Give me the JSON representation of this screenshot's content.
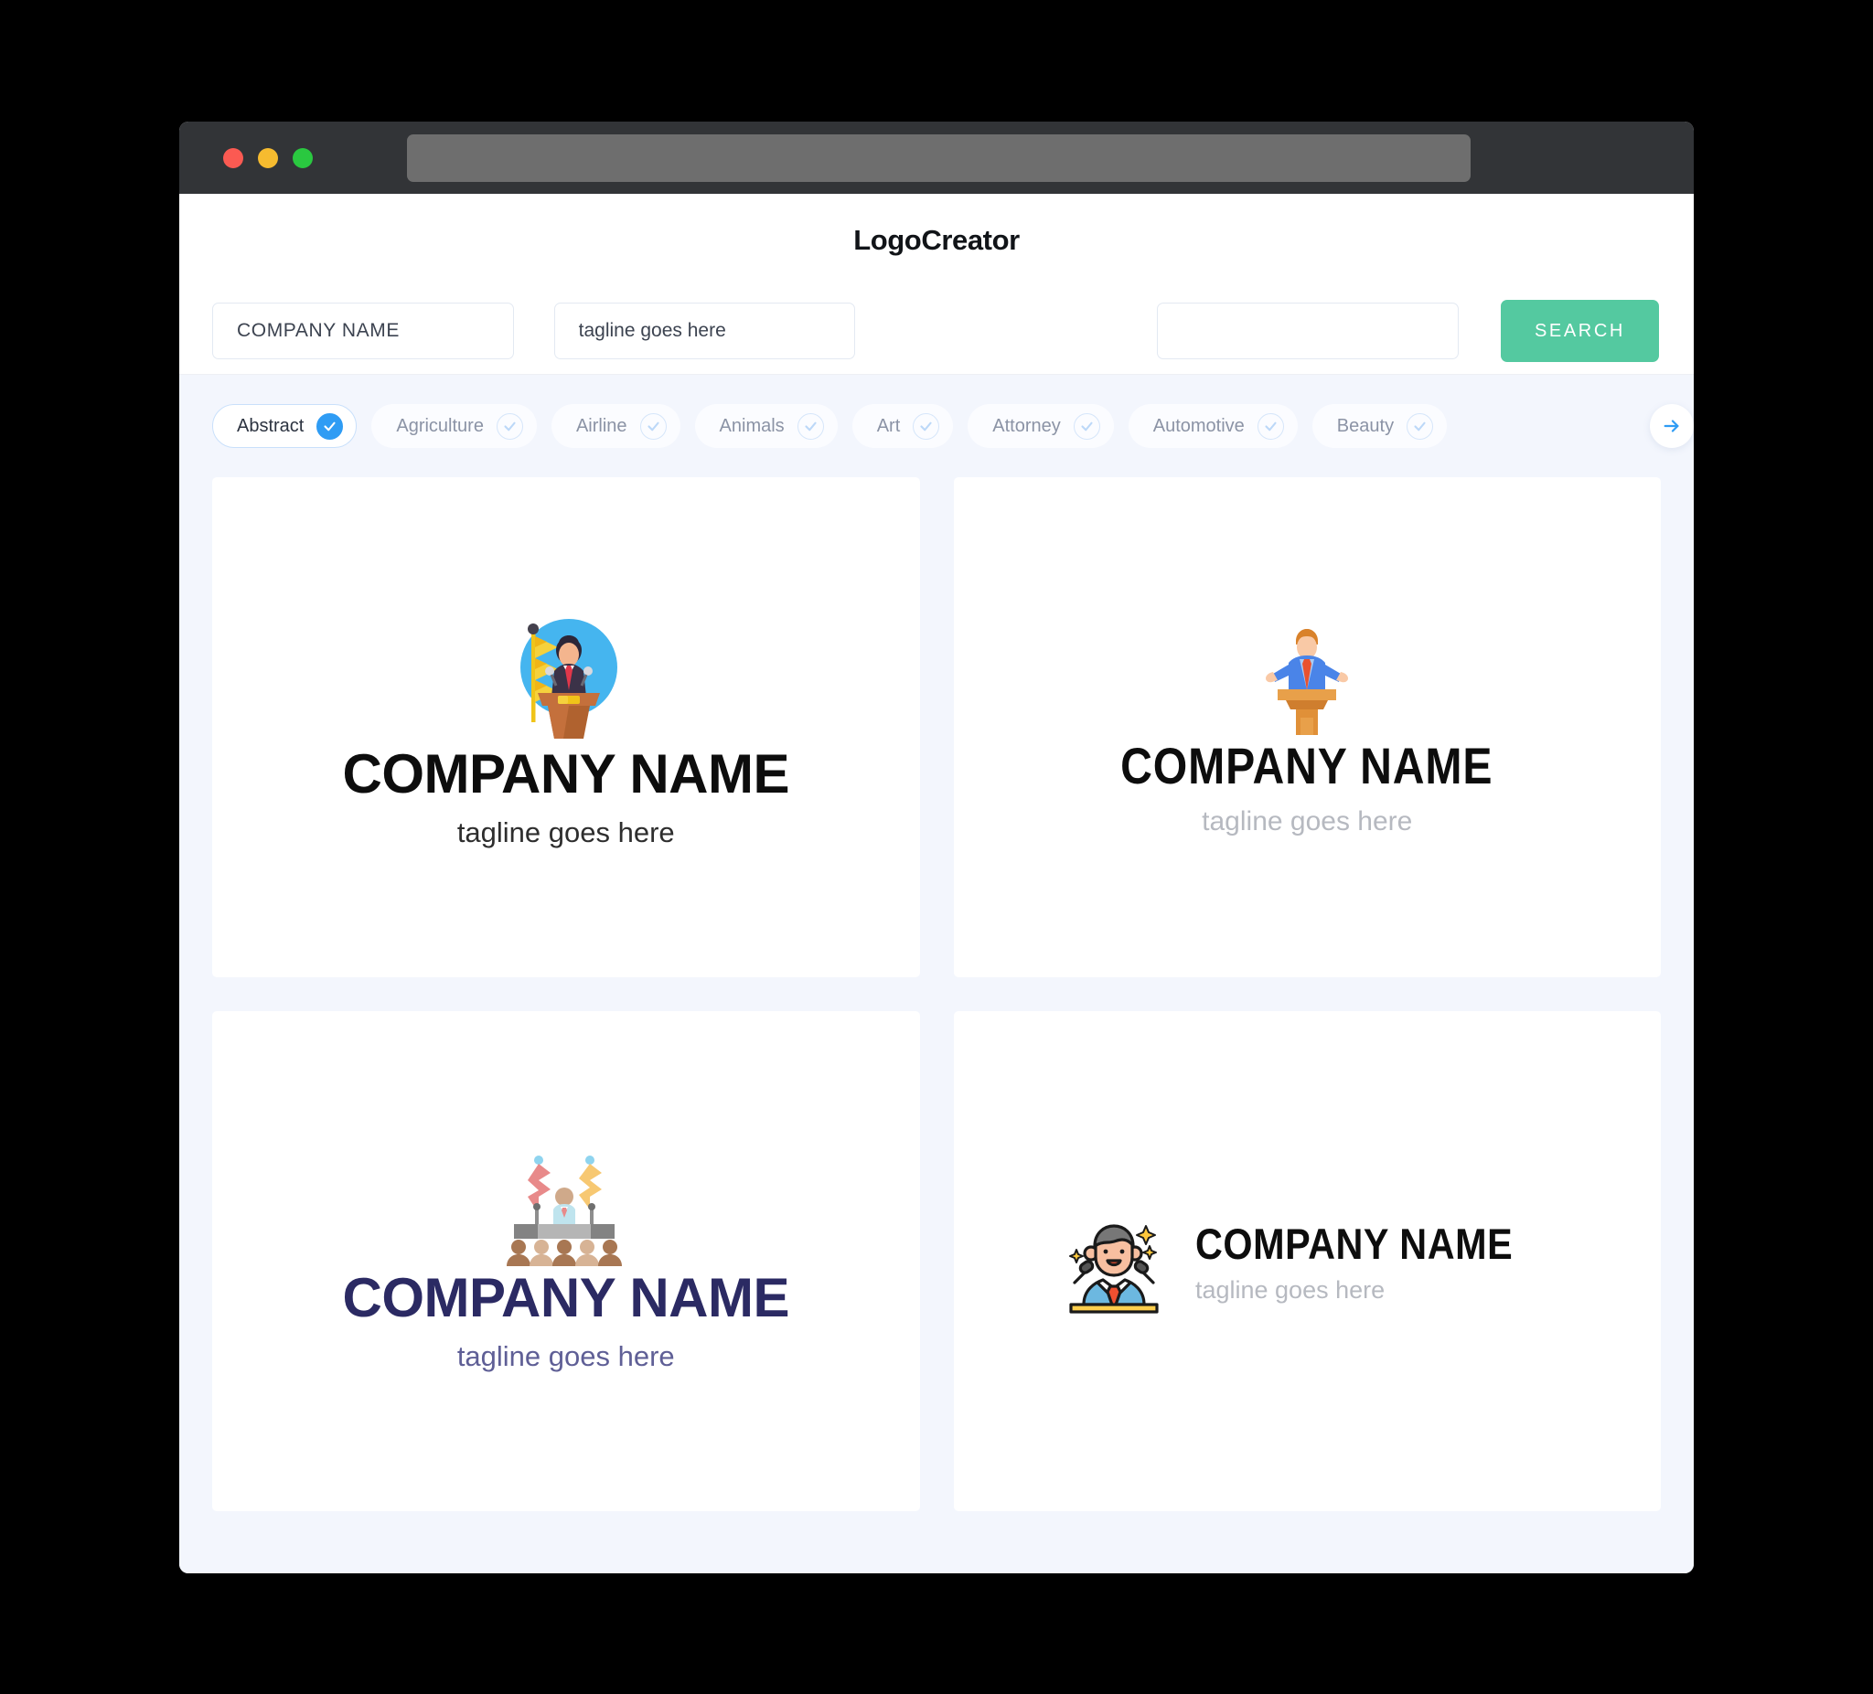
{
  "window": {
    "traffic_lights": [
      "close",
      "minimize",
      "maximize"
    ],
    "url_value": ""
  },
  "header": {
    "title": "LogoCreator"
  },
  "search": {
    "company_value": "COMPANY NAME",
    "tagline_value": "tagline goes here",
    "extra_value": "",
    "search_label": "SEARCH"
  },
  "categories": {
    "next_icon": "arrow-right-icon",
    "items": [
      {
        "label": "Abstract",
        "selected": true
      },
      {
        "label": "Agriculture",
        "selected": false
      },
      {
        "label": "Airline",
        "selected": false
      },
      {
        "label": "Animals",
        "selected": false
      },
      {
        "label": "Art",
        "selected": false
      },
      {
        "label": "Attorney",
        "selected": false
      },
      {
        "label": "Automotive",
        "selected": false
      },
      {
        "label": "Beauty",
        "selected": false
      }
    ]
  },
  "results": [
    {
      "id": "logo-card-1",
      "layout": "vertical",
      "icon": "speaker-podium-flag-icon",
      "company_name": "COMPANY NAME",
      "tagline": "tagline goes here",
      "name_color": "#0d0d0d",
      "tagline_color": "#2e2e2e"
    },
    {
      "id": "logo-card-2",
      "layout": "vertical",
      "icon": "speaker-arms-raised-podium-icon",
      "company_name": "COMPANY NAME",
      "tagline": "tagline goes here",
      "name_color": "#0d0d0d",
      "tagline_color": "#b6b9c0"
    },
    {
      "id": "logo-card-3",
      "layout": "vertical",
      "icon": "conference-stage-audience-icon",
      "company_name": "COMPANY NAME",
      "tagline": "tagline goes here",
      "name_color": "#2b2a63",
      "tagline_color": "#5f5f96"
    },
    {
      "id": "logo-card-4",
      "layout": "horizontal",
      "icon": "news-anchor-microphones-icon",
      "company_name": "COMPANY NAME",
      "tagline": "tagline goes here",
      "name_color": "#0d0d0d",
      "tagline_color": "#b6b9c0"
    }
  ],
  "colors": {
    "accent_green": "#54c9a0",
    "accent_blue": "#2f9cf4",
    "page_bg": "#f3f6fd",
    "titlebar": "#323437"
  }
}
